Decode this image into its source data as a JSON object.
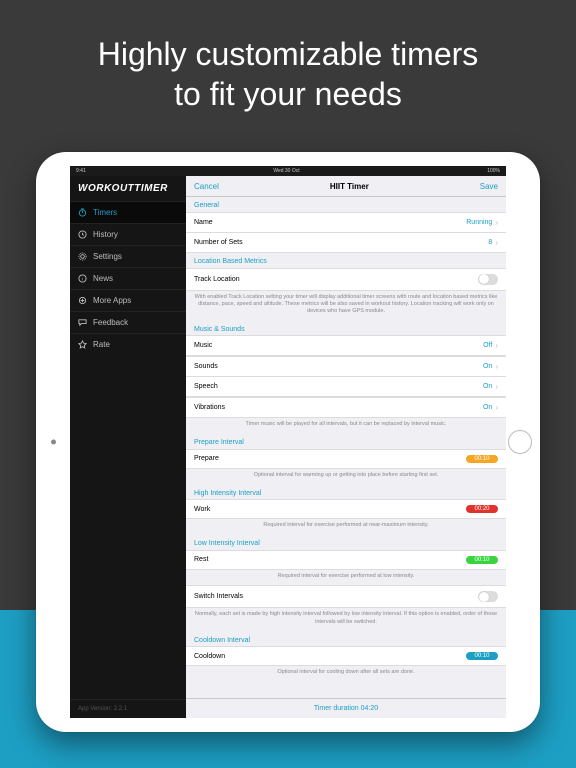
{
  "marketing": {
    "headline_l1": "Highly customizable timers",
    "headline_l2": "to fit your needs"
  },
  "statusbar": {
    "time": "9:41",
    "date": "Wed 30 Oct"
  },
  "sidebar": {
    "brand": "WORKOUTTIMER",
    "items": [
      {
        "icon": "timer-icon",
        "label": "Timers",
        "active": true
      },
      {
        "icon": "history-icon",
        "label": "History"
      },
      {
        "icon": "gear-icon",
        "label": "Settings"
      },
      {
        "icon": "news-icon",
        "label": "News"
      },
      {
        "icon": "apps-icon",
        "label": "More Apps"
      },
      {
        "icon": "feedback-icon",
        "label": "Feedback"
      },
      {
        "icon": "star-icon",
        "label": "Rate"
      }
    ],
    "version": "App Version: 2.2.1"
  },
  "navbar": {
    "cancel": "Cancel",
    "title": "HIIT Timer",
    "save": "Save"
  },
  "sections": {
    "general": {
      "header": "General",
      "name_label": "Name",
      "name_value": "Running",
      "sets_label": "Number of Sets",
      "sets_value": "8"
    },
    "location": {
      "header": "Location Based Metrics",
      "track_label": "Track Location",
      "hint": "With enabled Track Location setting your timer will display additional timer screens with route and location based metrics like distance, pace, speed and altitude. These metrics will be also saved in workout history. Location tracking will work only on devices who have GPS module."
    },
    "music": {
      "header": "Music & Sounds",
      "music_label": "Music",
      "music_value": "Off",
      "sounds_label": "Sounds",
      "sounds_value": "On",
      "speech_label": "Speech",
      "speech_value": "On",
      "vibrations_label": "Vibrations",
      "vibrations_value": "On",
      "hint": "Timer music will be played for all intervals, but it can be replaced by interval music."
    },
    "prepare": {
      "header": "Prepare Interval",
      "label": "Prepare",
      "value": "00:10",
      "hint": "Optional interval for warming up or getting into place before starting first set."
    },
    "high": {
      "header": "High Intensity Interval",
      "label": "Work",
      "value": "00:20",
      "hint": "Required interval for exercise performed at near-maximum intensity."
    },
    "low": {
      "header": "Low Intensity Interval",
      "label": "Rest",
      "value": "00:10",
      "hint": "Required interval for exercise performed at low intensity."
    },
    "switch": {
      "label": "Switch Intervals",
      "hint": "Normally, each set is made by high intensity interval followed by low intensity interval. If this option is enabled, order of those intervals will be switched."
    },
    "cooldown": {
      "header": "Cooldown Interval",
      "label": "Cooldown",
      "value": "00:10",
      "hint": "Optional interval for cooling down after all sets are done."
    }
  },
  "footer": "Timer duration 04:20"
}
